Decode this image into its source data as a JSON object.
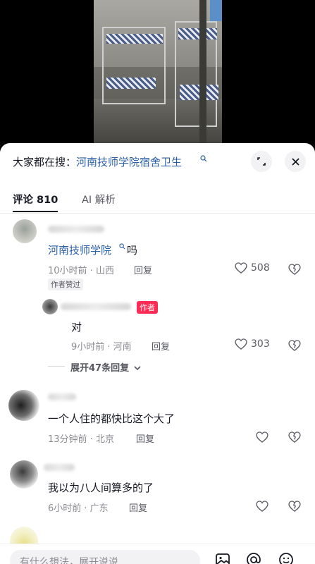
{
  "search": {
    "prefix": "大家都在搜：",
    "term": "河南技师学院宿舍卫生",
    "expand_icon": "expand-icon",
    "close_icon": "close-icon"
  },
  "tabs": [
    {
      "label": "评论 810",
      "active": true
    },
    {
      "label": "AI 解析",
      "active": false
    }
  ],
  "comments": [
    {
      "text_link": "河南技师学院",
      "text_rest": "吗",
      "meta": "10小时前 · 山西",
      "reply_label": "回复",
      "likes": "508",
      "badge": "作者赞过"
    },
    {
      "author_badge": "作者",
      "text": "对",
      "meta": "9小时前 · 河南",
      "reply_label": "回复",
      "likes": "303"
    },
    {
      "text": "一个人住的都快比这个大了",
      "meta": "13分钟前 · 北京",
      "reply_label": "回复"
    },
    {
      "text": "我以为八人间算多的了",
      "meta": "6小时前 · 广东",
      "reply_label": "回复"
    }
  ],
  "expand_replies": "展开47条回复",
  "bottom": {
    "placeholder": "有什么想法，展开说说",
    "icons": [
      "image-icon",
      "at-icon",
      "emoji-icon"
    ]
  },
  "colors": {
    "link": "#2b5fa7",
    "author_badge": "#fe2c55",
    "text": "#161823",
    "meta": "#8a8b91"
  }
}
